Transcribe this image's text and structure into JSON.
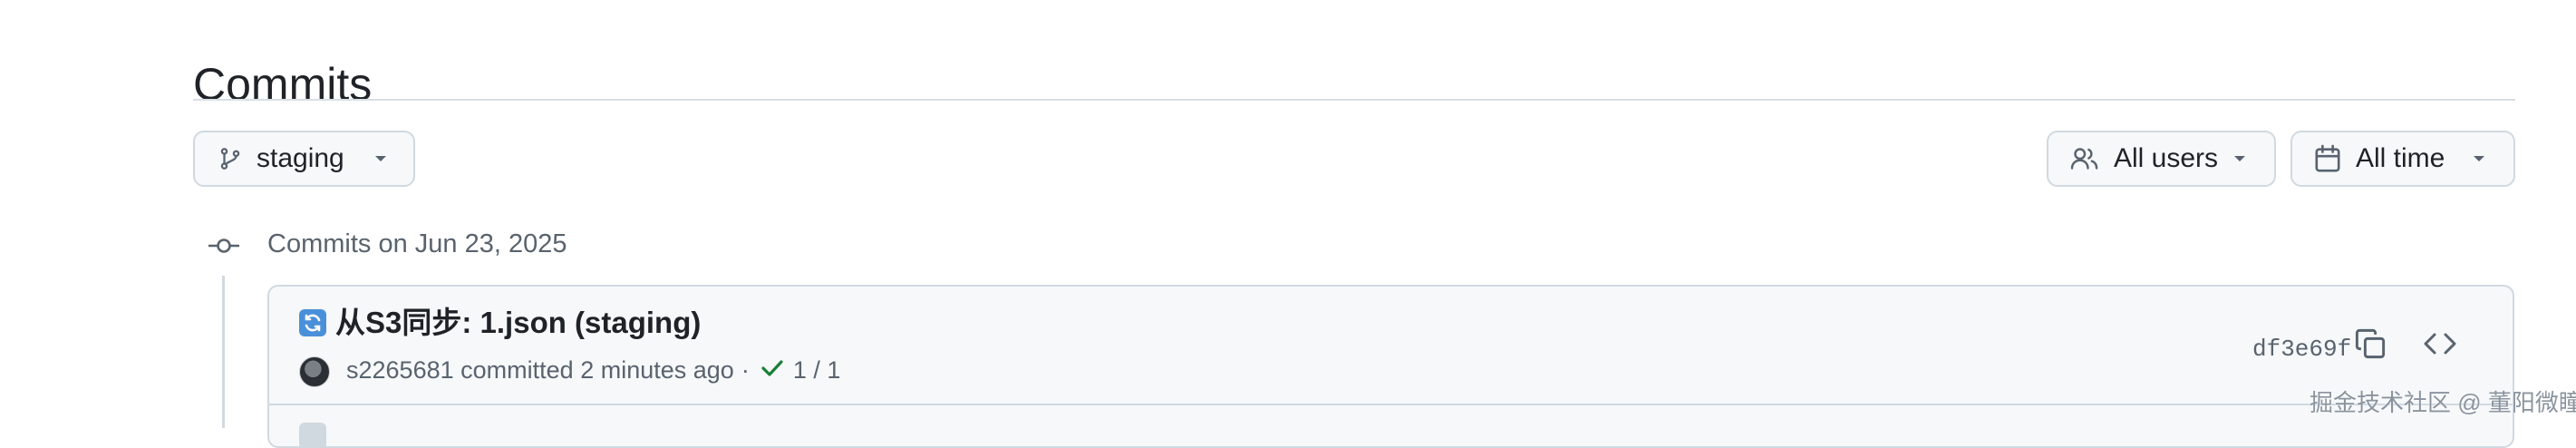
{
  "page": {
    "title": "Commits"
  },
  "filters": {
    "branch": {
      "label": "staging",
      "icon": "git-branch-icon"
    },
    "users": {
      "label": "All users",
      "icon": "people-icon"
    },
    "time": {
      "label": "All time",
      "icon": "calendar-icon"
    }
  },
  "groups": [
    {
      "heading": "Commits on Jun 23, 2025",
      "commits": [
        {
          "emoji": "arrows-counterclockwise-icon",
          "title": "从S3同步: 1.json (staging)",
          "author": "s2265681",
          "action": "committed",
          "time": "2 minutes ago",
          "separator": "·",
          "checks": "1 / 1",
          "sha": "df3e69f"
        }
      ]
    }
  ],
  "watermark": "掘金技术社区 @ 董阳微瞳",
  "colors": {
    "border": "#d1d9e0",
    "muted_text": "#59636e",
    "success": "#1a7f37",
    "box_bg": "#f6f8fa"
  }
}
